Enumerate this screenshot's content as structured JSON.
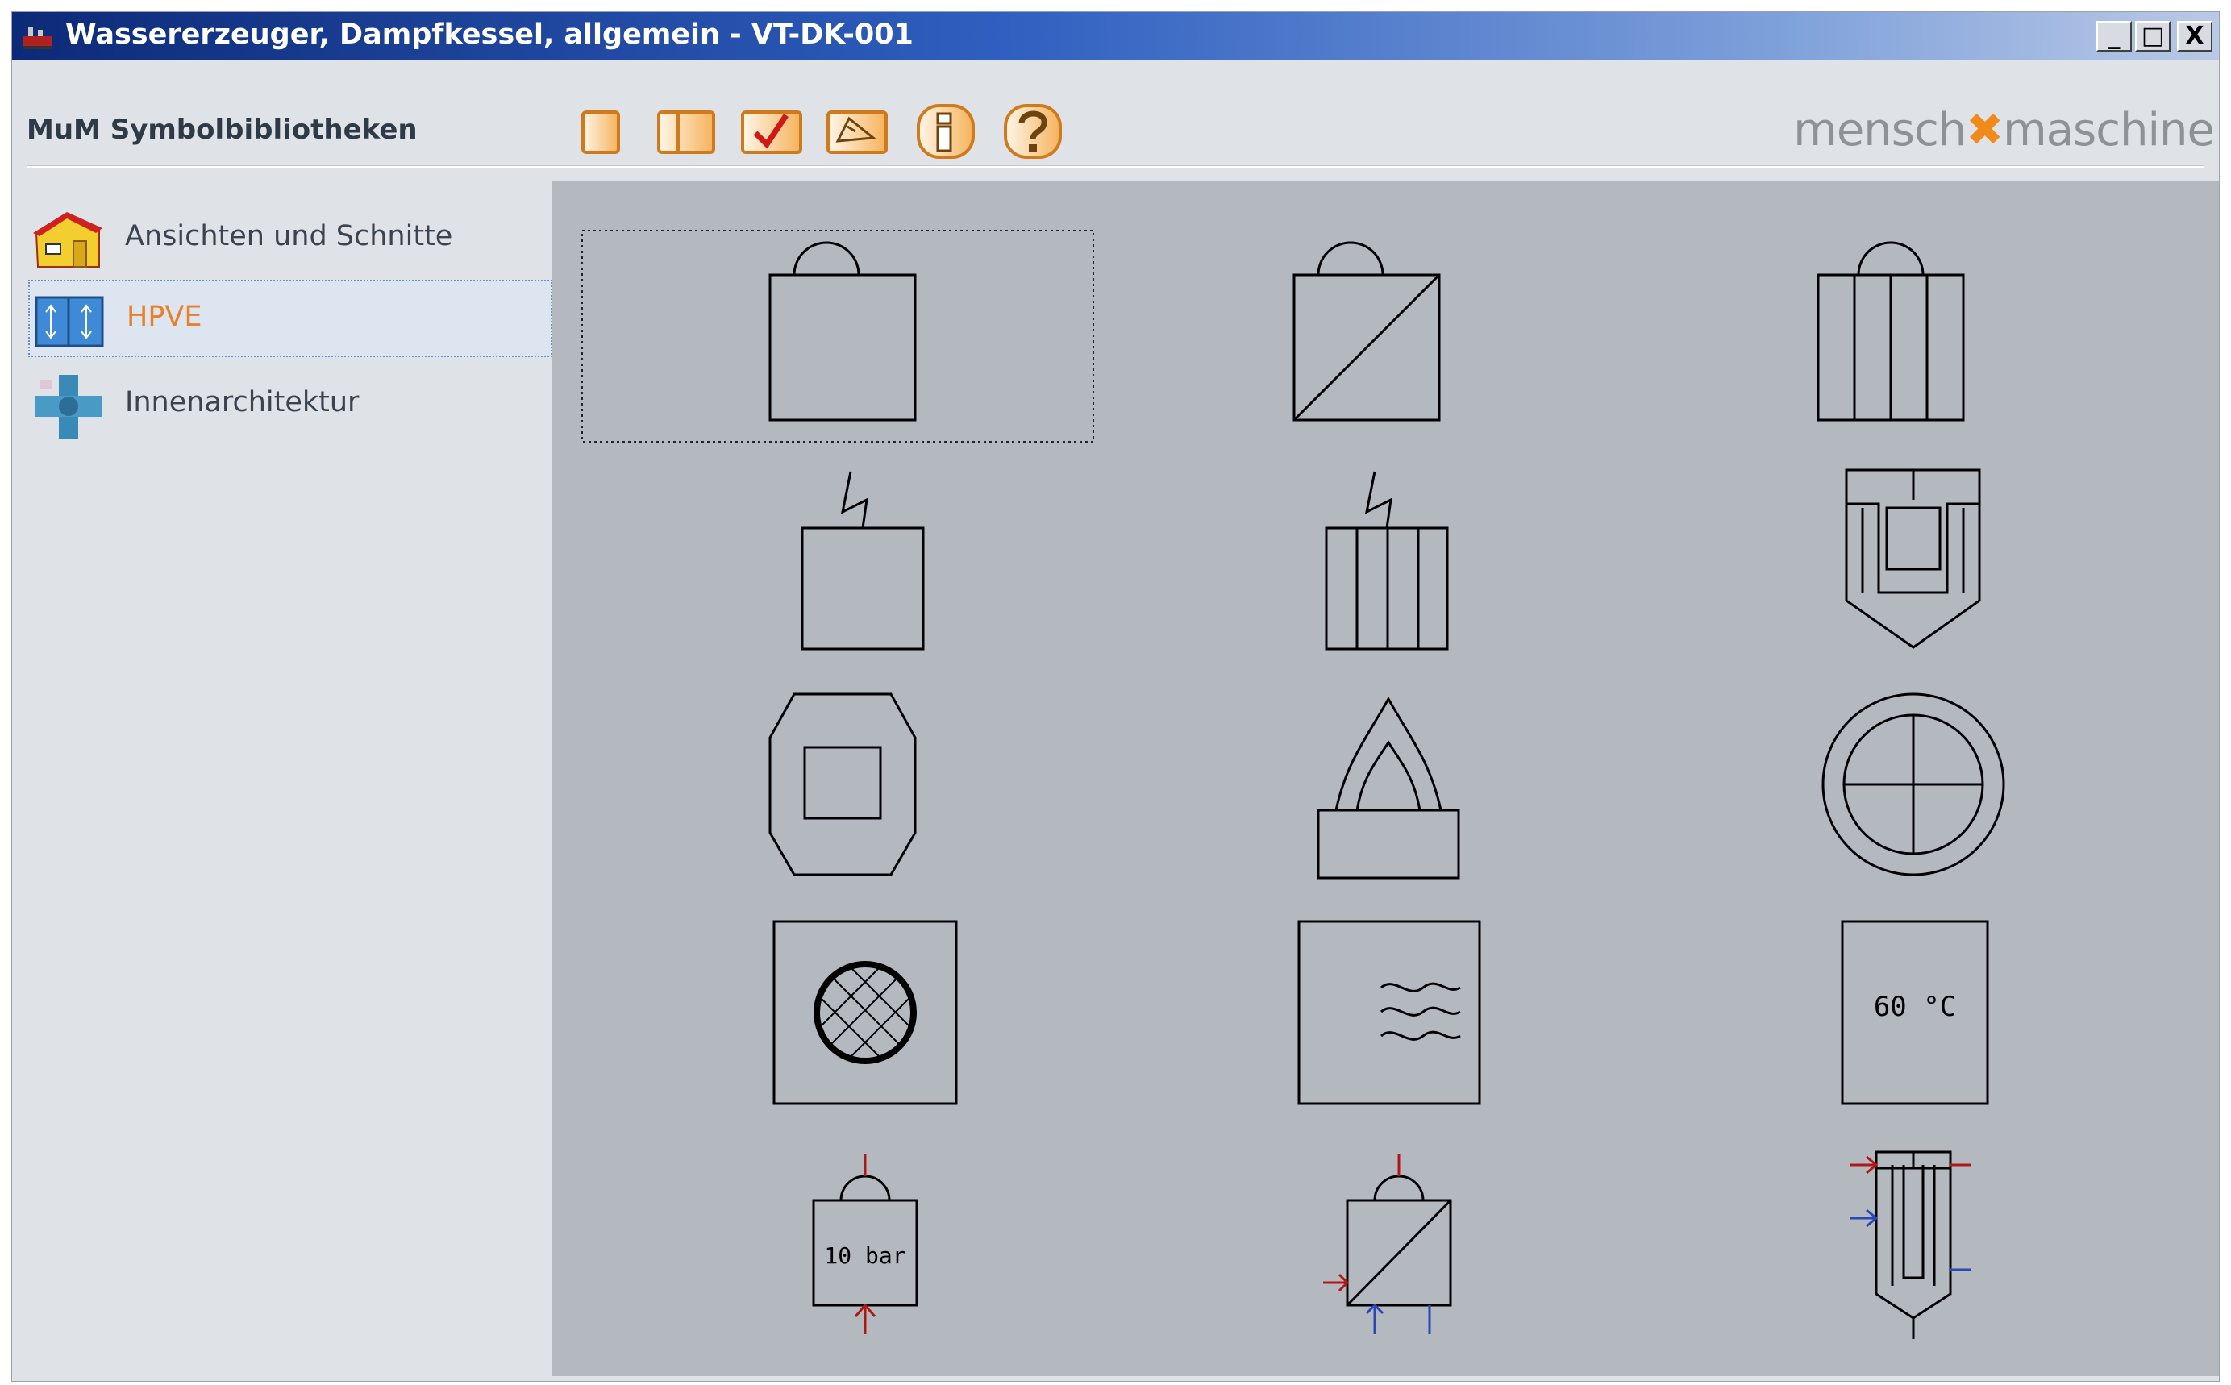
{
  "window": {
    "title": "Wassererzeuger, Dampfkessel, allgemein - VT-DK-001",
    "controls": [
      "_",
      "□",
      "X"
    ]
  },
  "toolbar": {
    "library_title": "MuM Symbolbibliotheken",
    "buttons": [
      {
        "icon": "single-pane-icon"
      },
      {
        "icon": "split-pane-icon"
      },
      {
        "icon": "check-icon"
      },
      {
        "icon": "pick-icon"
      },
      {
        "icon": "info-icon"
      },
      {
        "icon": "help-icon"
      }
    ],
    "brand_left": "mensch",
    "brand_sep": "✖",
    "brand_right": "maschine"
  },
  "sidebar": {
    "items": [
      {
        "label": "Ansichten und Schnitte",
        "icon": "house-icon",
        "active": false
      },
      {
        "label": "HPVE",
        "icon": "hpve-icon",
        "active": true
      },
      {
        "label": "Innenarchitektur",
        "icon": "interior-icon",
        "active": false
      }
    ]
  },
  "symbols": {
    "selected_index": 0,
    "labels": {
      "temperature": "60 °C",
      "pressure": "10 bar"
    },
    "items": [
      "steam-boiler-symbol",
      "steam-boiler-diagonal-symbol",
      "steam-boiler-ribbed-symbol",
      "electric-boiler-symbol",
      "electric-ribbed-boiler-symbol",
      "shielded-heater-symbol",
      "octagon-boiler-symbol",
      "flame-burner-symbol",
      "circle-cross-symbol",
      "hatched-circle-symbol",
      "wave-heater-symbol",
      "temperature-heater-symbol",
      "pressure-boiler-symbol",
      "diagonal-boiler-connections-symbol",
      "tube-heater-symbol"
    ]
  },
  "colors": {
    "title_gradient_start": "#0d2a78",
    "accent_orange": "#e8802a",
    "content_bg": "#b4b9bf",
    "connection_red": "#b01818",
    "connection_blue": "#2848b8"
  }
}
